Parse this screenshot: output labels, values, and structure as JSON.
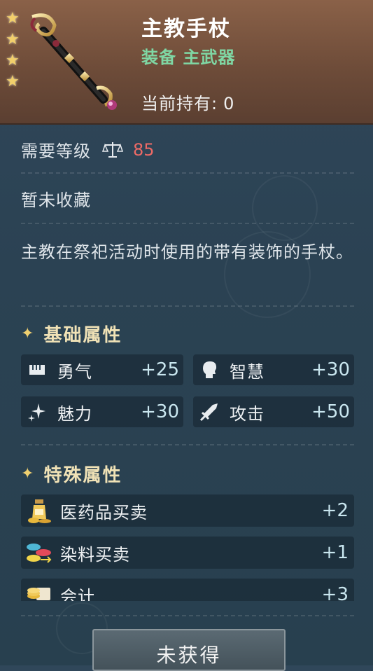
{
  "header": {
    "title": "主教手杖",
    "subtitle": "装备 主武器",
    "holding_label": "当前持有:",
    "holding_value": "0",
    "stars": 4
  },
  "required_level": {
    "label": "需要等级",
    "value": "85",
    "icon": "scales-icon"
  },
  "collection_status": "暂未收藏",
  "description": "主教在祭祀活动时使用的带有装饰的手杖。",
  "basic_attributes": {
    "title": "基础属性",
    "items": [
      {
        "label": "勇气",
        "value": "+25",
        "icon": "courage-icon"
      },
      {
        "label": "智慧",
        "value": "+30",
        "icon": "wisdom-head-icon"
      },
      {
        "label": "魅力",
        "value": "+30",
        "icon": "charm-sparkle-icon"
      },
      {
        "label": "攻击",
        "value": "+50",
        "icon": "sword-icon"
      }
    ]
  },
  "special_attributes": {
    "title": "特殊属性",
    "items": [
      {
        "label": "医药品买卖",
        "value": "+2",
        "icon": "medicine-bottle-icon"
      },
      {
        "label": "染料买卖",
        "value": "+1",
        "icon": "dye-bowls-icon"
      },
      {
        "label": "会计",
        "value": "+3",
        "icon": "coins-scroll-icon"
      }
    ]
  },
  "action_button": {
    "label": "未获得"
  },
  "colors": {
    "header_bg": "#7a5540",
    "panel_bg": "#2d4456",
    "subtitle_green": "#7fd7a4",
    "level_red": "#ec6a66",
    "section_gold": "#f0e2b6",
    "stat_value": "#c9e6ef"
  }
}
